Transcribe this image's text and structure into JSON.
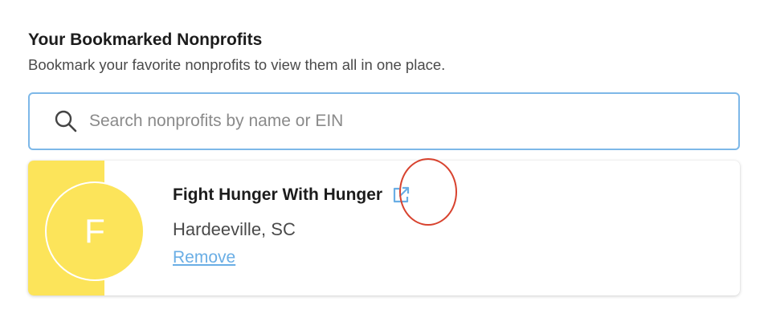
{
  "section": {
    "title": "Your Bookmarked Nonprofits",
    "subtitle": "Bookmark your favorite nonprofits to view them all in one place."
  },
  "search": {
    "placeholder": "Search nonprofits by name or EIN",
    "value": "",
    "icon": "search-icon"
  },
  "bookmarks": [
    {
      "initial": "F",
      "name": "Fight Hunger With Hunger",
      "location": "Hardeeville, SC",
      "remove_label": "Remove",
      "link_icon": "external-link-icon",
      "accent_color": "#fce45a"
    }
  ],
  "colors": {
    "search_border": "#7db8e8",
    "link": "#6aaee5",
    "annotation": "#d8432f"
  }
}
